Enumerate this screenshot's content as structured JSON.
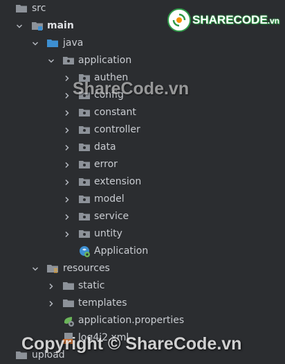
{
  "tree": {
    "src": "src",
    "main": "main",
    "java": "java",
    "application_pkg": "application",
    "packages": [
      "authen",
      "config",
      "constant",
      "controller",
      "data",
      "error",
      "extension",
      "model",
      "service",
      "untity"
    ],
    "application_class": "Application",
    "resources": "resources",
    "resource_folders": [
      "static",
      "templates"
    ],
    "application_properties": "application.properties",
    "log4j2": "log4j2.xml",
    "upload": "upload"
  },
  "watermarks": {
    "logo_main": "SHARECODE",
    "logo_suffix": ".vn",
    "center": "ShareCode.vn",
    "bottom": "Copyright © ShareCode.vn"
  },
  "colors": {
    "background": "#2b2d30",
    "text": "#c9ccd1",
    "folder": "#8d9299",
    "source_root": "#3d8fd1",
    "spring_green": "#6bb55a"
  }
}
